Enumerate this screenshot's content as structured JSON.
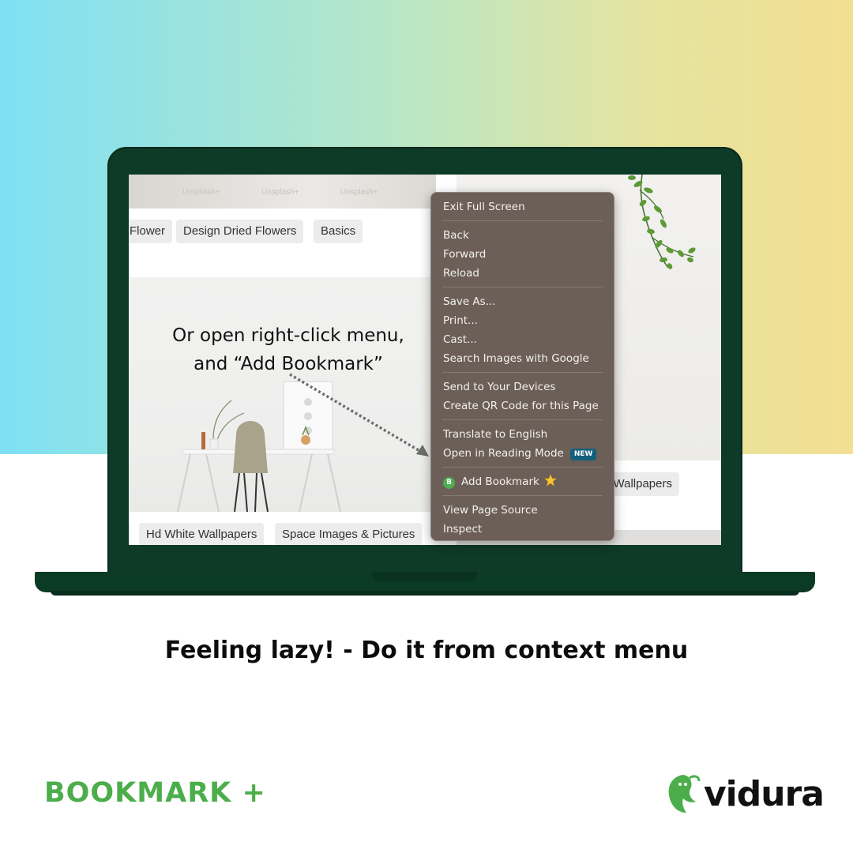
{
  "screen": {
    "top_strip_ghosts": [
      "Unsplash+",
      "Unsplash+",
      "Unsplash+"
    ],
    "chips_top": [
      "Flower",
      "Design Dried Flowers",
      "Basics"
    ],
    "chips_bottom": [
      "Hd White Wallpapers",
      "Space Images & Pictures"
    ],
    "chip_right": "n Wallpapers",
    "annotation": {
      "line1": "Or open right-click menu,",
      "line2": "and “Add Bookmark”"
    }
  },
  "context_menu": {
    "group1": [
      "Exit Full Screen"
    ],
    "group2": [
      "Back",
      "Forward",
      "Reload"
    ],
    "group3": [
      "Save As...",
      "Print...",
      "Cast...",
      "Search Images with Google"
    ],
    "group4": [
      "Send to Your Devices",
      "Create QR Code for this Page"
    ],
    "group5_item1": "Translate to English",
    "group5_item2": "Open in Reading Mode",
    "new_badge": "NEW",
    "bookmark_icon_letter": "B",
    "add_bookmark": "Add Bookmark",
    "star_icon": "star-icon",
    "group7": [
      "View Page Source",
      "Inspect"
    ]
  },
  "caption": "Feeling lazy!  - Do it from context menu",
  "brand": "BOOKMARK +",
  "logo": {
    "text": "vidura",
    "icon": "sloth-icon"
  },
  "colors": {
    "gradient_left": "#7fe0f4",
    "gradient_right": "#f3df92",
    "laptop": "#0e3a28",
    "menu_bg": "#6b5f58",
    "brand_green": "#4cae4b",
    "new_badge": "#13607c"
  }
}
